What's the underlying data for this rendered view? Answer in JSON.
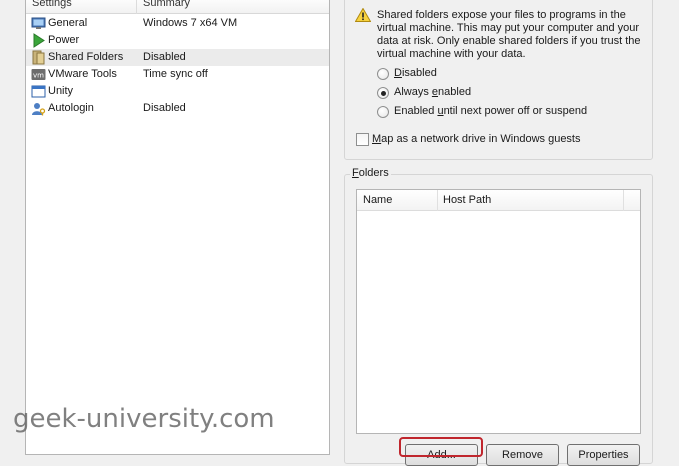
{
  "settings_list": {
    "headers": {
      "settings": "Settings",
      "summary": "Summary"
    },
    "rows": [
      {
        "label": "General",
        "summary": "Windows 7 x64 VM",
        "icon": "monitor-icon"
      },
      {
        "label": "Power",
        "summary": "",
        "icon": "play-icon"
      },
      {
        "label": "Shared Folders",
        "summary": "Disabled",
        "icon": "folder-icon",
        "selected": true
      },
      {
        "label": "VMware Tools",
        "summary": "Time sync off",
        "icon": "vm-icon"
      },
      {
        "label": "Unity",
        "summary": "",
        "icon": "window-icon"
      },
      {
        "label": "Autologin",
        "summary": "Disabled",
        "icon": "user-key-icon"
      }
    ]
  },
  "sharing": {
    "warning": "Shared folders expose your files to programs in the virtual machine. This may put your computer and your data at risk. Only enable shared folders if you trust the virtual machine with your data.",
    "options": [
      {
        "label": "Disabled",
        "checked": false
      },
      {
        "label": "Always enabled",
        "checked": true
      },
      {
        "label": "Enabled until next power off or suspend",
        "checked": false
      }
    ],
    "map_drive_label": "Map as a network drive in Windows guests",
    "map_drive_checked": false
  },
  "folders": {
    "title": "Folders",
    "columns": {
      "name": "Name",
      "host_path": "Host Path"
    },
    "buttons": {
      "add": "Add...",
      "remove": "Remove",
      "properties": "Properties"
    }
  },
  "watermark": "geek-university.com",
  "colors": {
    "highlight": "#c0262d",
    "selected_row": "#ebebeb"
  }
}
